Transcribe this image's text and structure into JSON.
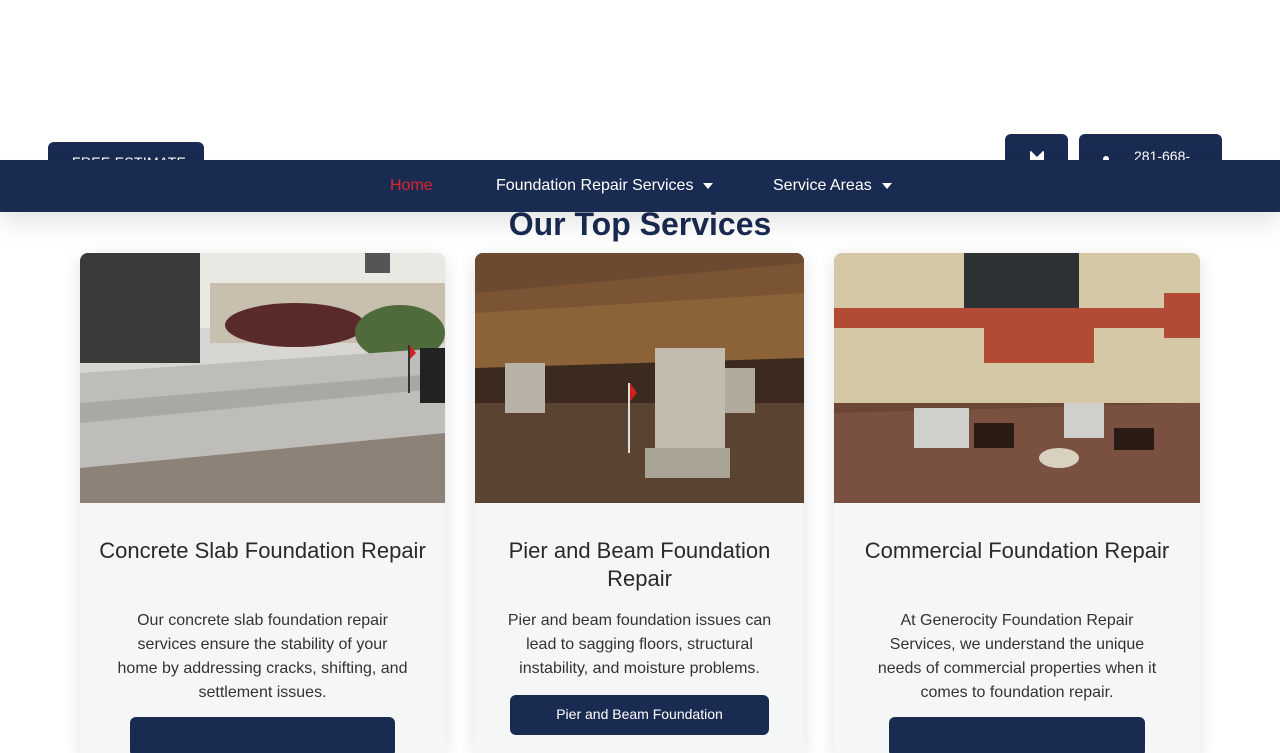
{
  "header": {
    "free_estimate_label": "FREE ESTIMATE",
    "phone_label": "281-668-",
    "mail_icon": "envelope-icon",
    "phone_icon": "phone-icon"
  },
  "nav": {
    "items": [
      {
        "label": "Home",
        "active": true
      },
      {
        "label": "Foundation Repair Services",
        "has_dropdown": true
      },
      {
        "label": "Service Areas",
        "has_dropdown": true
      }
    ]
  },
  "section": {
    "title": "Our Top Services"
  },
  "cards": [
    {
      "title": "Concrete Slab Foundation Repair",
      "description": "Our concrete slab foundation repair services ensure the stability of your home by addressing cracks, shifting, and settlement issues.",
      "button_label": ""
    },
    {
      "title": "Pier and Beam Foundation Repair",
      "description": "Pier and beam foundation issues can lead to sagging floors, structural instability, and moisture problems.",
      "button_label": "Pier and Beam Foundation"
    },
    {
      "title": "Commercial Foundation Repair",
      "description": "At Generocity Foundation Repair Services, we understand the unique needs of commercial properties when it comes to foundation repair.",
      "button_label": ""
    }
  ],
  "colors": {
    "brand_navy": "#1a2b52",
    "active_red": "#e0242f",
    "card_bg": "#f5f6f6"
  }
}
